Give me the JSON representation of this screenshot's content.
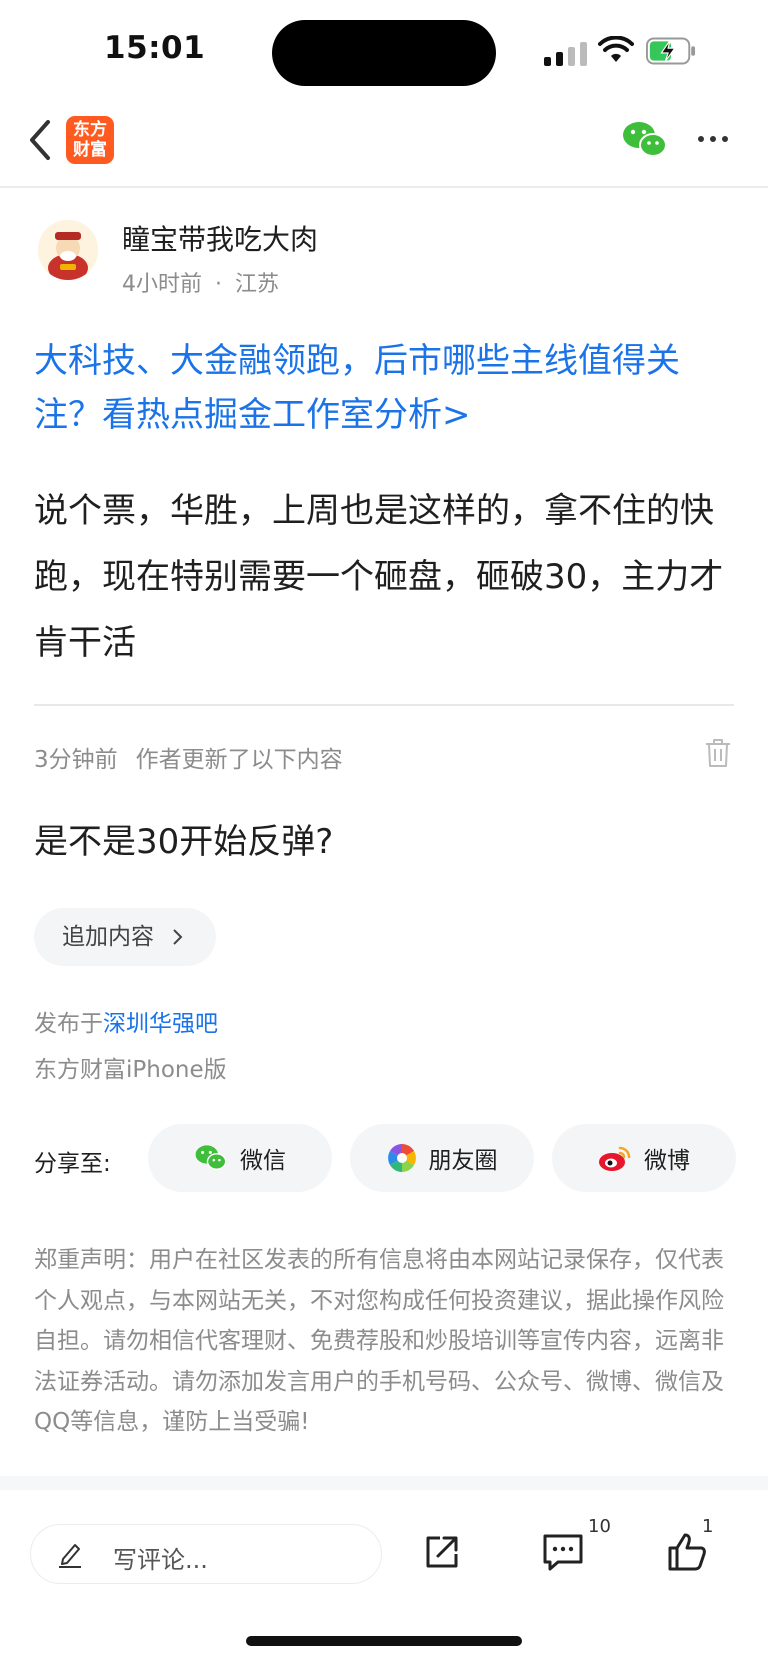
{
  "status_bar": {
    "time": "15:01"
  },
  "nav": {
    "logo_line1": "东方",
    "logo_line2": "财富",
    "icons": [
      "back-icon",
      "wechat-icon",
      "more-icon"
    ]
  },
  "author": {
    "name": "瞳宝带我吃大肉",
    "time": "4小时前",
    "location": "江苏",
    "separator": "·"
  },
  "post": {
    "title": "大科技、大金融领跑，后市哪些主线值得关注？看热点掘金工作室分析>",
    "body": "说个票，华胜，上周也是这样的，拿不住的快跑，现在特别需要一个砸盘，砸破30，主力才肯干活"
  },
  "update": {
    "time": "3分钟前",
    "label": "作者更新了以下内容",
    "content": "是不是30开始反弹?"
  },
  "add_content_label": "追加内容",
  "publish": {
    "prefix": "发布于",
    "bar": "深圳华强吧",
    "platform": "东方财富iPhone版"
  },
  "share": {
    "label": "分享至:",
    "buttons": [
      {
        "label": "微信",
        "icon": "wechat-icon"
      },
      {
        "label": "朋友圈",
        "icon": "moments-icon"
      },
      {
        "label": "微博",
        "icon": "weibo-icon"
      }
    ]
  },
  "disclaimer": "郑重声明：用户在社区发表的所有信息将由本网站记录保存，仅代表个人观点，与本网站无关，不对您构成任何投资建议，据此操作风险自担。请勿相信代客理财、免费荐股和炒股培训等宣传内容，远离非法证券活动。请勿添加发言用户的手机号码、公众号、微博、微信及QQ等信息，谨防上当受骗!",
  "bottom_bar": {
    "comment_placeholder": "写评论...",
    "comment_count": "10",
    "like_count": "1"
  },
  "colors": {
    "link_blue": "#1a73e8",
    "brand_orange": "#ff5a1f",
    "wechat_green": "#3fbe3c"
  }
}
